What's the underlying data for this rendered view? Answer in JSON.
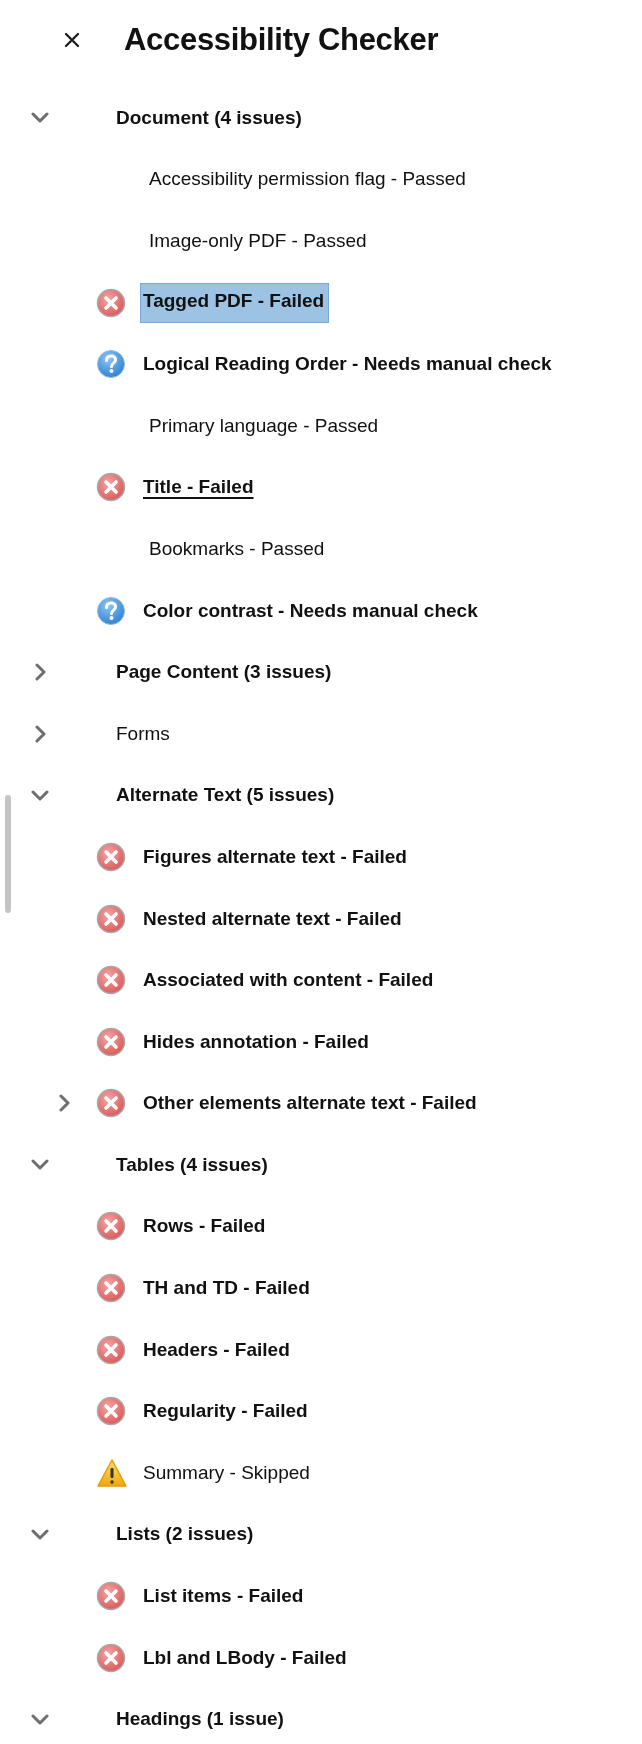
{
  "panel": {
    "title": "Accessibility Checker"
  },
  "groups": [
    {
      "label": "Document (4 issues)",
      "expanded": true,
      "has_issues": true,
      "children": [
        {
          "label": "Accessibility permission flag - Passed",
          "kind": "passed",
          "selected": false,
          "hovered": false,
          "expandable": false
        },
        {
          "label": "Image-only PDF - Passed",
          "kind": "passed",
          "selected": false,
          "hovered": false,
          "expandable": false
        },
        {
          "label": "Tagged PDF - Failed",
          "kind": "failed",
          "selected": true,
          "hovered": false,
          "expandable": false
        },
        {
          "label": "Logical Reading Order - Needs manual check",
          "kind": "manual",
          "selected": false,
          "hovered": false,
          "expandable": false
        },
        {
          "label": "Primary language - Passed",
          "kind": "passed",
          "selected": false,
          "hovered": false,
          "expandable": false
        },
        {
          "label": "Title - Failed",
          "kind": "failed",
          "selected": false,
          "hovered": true,
          "expandable": false
        },
        {
          "label": "Bookmarks - Passed",
          "kind": "passed",
          "selected": false,
          "hovered": false,
          "expandable": false
        },
        {
          "label": "Color contrast - Needs manual check",
          "kind": "manual",
          "selected": false,
          "hovered": false,
          "expandable": false
        }
      ]
    },
    {
      "label": "Page Content (3 issues)",
      "expanded": false,
      "has_issues": true
    },
    {
      "label": "Forms",
      "expanded": false,
      "has_issues": false
    },
    {
      "label": "Alternate Text (5 issues)",
      "expanded": true,
      "has_issues": true,
      "children": [
        {
          "label": "Figures alternate text - Failed",
          "kind": "failed",
          "selected": false,
          "hovered": false,
          "expandable": false
        },
        {
          "label": "Nested alternate text - Failed",
          "kind": "failed",
          "selected": false,
          "hovered": false,
          "expandable": false
        },
        {
          "label": "Associated with content - Failed",
          "kind": "failed",
          "selected": false,
          "hovered": false,
          "expandable": false
        },
        {
          "label": "Hides annotation - Failed",
          "kind": "failed",
          "selected": false,
          "hovered": false,
          "expandable": false
        },
        {
          "label": "Other elements alternate text - Failed",
          "kind": "failed",
          "selected": false,
          "hovered": false,
          "expandable": true
        }
      ]
    },
    {
      "label": "Tables (4 issues)",
      "expanded": true,
      "has_issues": true,
      "children": [
        {
          "label": "Rows - Failed",
          "kind": "failed",
          "selected": false,
          "hovered": false,
          "expandable": false
        },
        {
          "label": "TH and TD - Failed",
          "kind": "failed",
          "selected": false,
          "hovered": false,
          "expandable": false
        },
        {
          "label": "Headers - Failed",
          "kind": "failed",
          "selected": false,
          "hovered": false,
          "expandable": false
        },
        {
          "label": "Regularity - Failed",
          "kind": "failed",
          "selected": false,
          "hovered": false,
          "expandable": false
        },
        {
          "label": "Summary - Skipped",
          "kind": "skipped",
          "selected": false,
          "hovered": false,
          "expandable": false
        }
      ]
    },
    {
      "label": "Lists (2 issues)",
      "expanded": true,
      "has_issues": true,
      "children": [
        {
          "label": "List items - Failed",
          "kind": "failed",
          "selected": false,
          "hovered": false,
          "expandable": false
        },
        {
          "label": "Lbl and LBody - Failed",
          "kind": "failed",
          "selected": false,
          "hovered": false,
          "expandable": false
        }
      ]
    },
    {
      "label": "Headings (1 issue)",
      "expanded": true,
      "has_issues": true
    }
  ]
}
